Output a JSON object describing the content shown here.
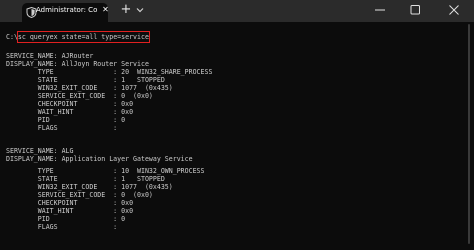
{
  "titlebar": {
    "tab_title": "Administrator: Command Prompt",
    "tab_close": "✕",
    "new_tab": "+",
    "icons": {
      "app": "shield-icon",
      "dropdown": "chevron-down-icon",
      "minimize": "minimize-icon",
      "maximize": "maximize-icon",
      "close": "close-icon"
    }
  },
  "console": {
    "prompt": "C:\\",
    "command": "sc queryex state=all type=service",
    "highlight_color": "#e02020",
    "lines": [
      "SERVICE_NAME: AJRouter",
      "DISPLAY_NAME: AllJoyn Router Service",
      "        TYPE               : 20  WIN32_SHARE_PROCESS",
      "        STATE              : 1   STOPPED",
      "        WIN32_EXIT_CODE    : 1077  (0x435)",
      "        SERVICE_EXIT_CODE  : 0  (0x0)",
      "        CHECKPOINT         : 0x0",
      "        WAIT_HINT          : 0x0",
      "        PID                : 0",
      "        FLAGS              :",
      "",
      "SERVICE_NAME: ALG",
      "DISPLAY_NAME: Application Layer Gateway Service",
      "        TYPE               : 10  WIN32_OWN_PROCESS",
      "        STATE              : 1   STOPPED",
      "        WIN32_EXIT_CODE    : 1077  (0x435)",
      "        SERVICE_EXIT_CODE  : 0  (0x0)",
      "        CHECKPOINT         : 0x0",
      "        WAIT_HINT          : 0x0",
      "        PID                : 0",
      "        FLAGS              :"
    ]
  }
}
